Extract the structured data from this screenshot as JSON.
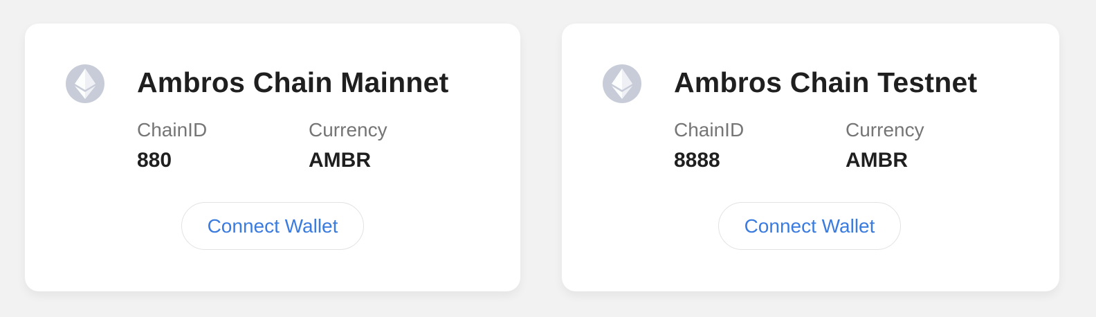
{
  "cards": [
    {
      "title": "Ambros Chain Mainnet",
      "icon": "ethereum-icon",
      "chain_id_label": "ChainID",
      "chain_id_value": "880",
      "currency_label": "Currency",
      "currency_value": "AMBR",
      "connect_label": "Connect Wallet"
    },
    {
      "title": "Ambros Chain Testnet",
      "icon": "ethereum-icon",
      "chain_id_label": "ChainID",
      "chain_id_value": "8888",
      "currency_label": "Currency",
      "currency_value": "AMBR",
      "connect_label": "Connect Wallet"
    }
  ],
  "colors": {
    "background": "#f2f2f2",
    "card": "#ffffff",
    "icon_circle": "#c7ccd8",
    "link_blue": "#3a7be0",
    "label_gray": "#757575",
    "text_dark": "#1f1f1f"
  }
}
